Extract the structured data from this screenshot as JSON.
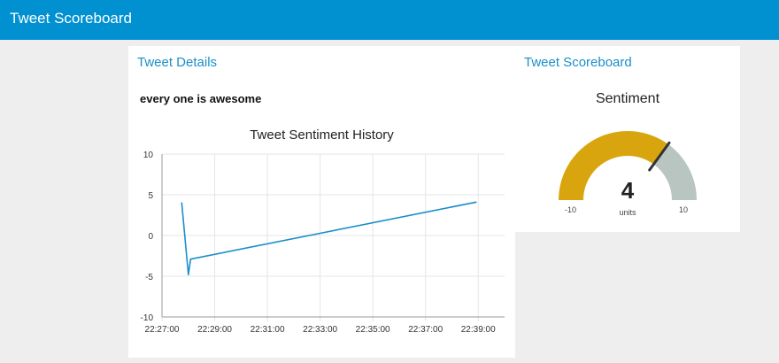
{
  "header": {
    "title": "Tweet Scoreboard"
  },
  "tweet_details": {
    "title": "Tweet Details",
    "text": "every one is awesome"
  },
  "scoreboard": {
    "title": "Tweet Scoreboard",
    "gauge": {
      "label": "Sentiment",
      "value": "4",
      "units": "units",
      "min": "-10",
      "max": "10",
      "numeric_value": 4,
      "numeric_min": -10,
      "numeric_max": 10,
      "fill_color": "#d9a50f",
      "remainder_color": "#b8c5c1",
      "needle_color": "#333333"
    }
  },
  "colors": {
    "header_bg": "#0190d0",
    "accent": "#1a8fca",
    "line": "#1a8fca"
  },
  "chart_data": {
    "type": "line",
    "title": "Tweet Sentiment History",
    "xlabel": "",
    "ylabel": "",
    "ylim": [
      -10,
      10
    ],
    "yticks": [
      "10",
      "5",
      "0",
      "-5",
      "-10"
    ],
    "ytick_values": [
      10,
      5,
      0,
      -5,
      -10
    ],
    "xticks": [
      "22:27:00",
      "22:29:00",
      "22:31:00",
      "22:33:00",
      "22:35:00",
      "22:37:00",
      "22:39:00"
    ],
    "xtick_values": [
      "22:27:00",
      "22:29:00",
      "22:31:00",
      "22:33:00",
      "22:35:00",
      "22:37:00",
      "22:39:00"
    ],
    "grid": true,
    "series": [
      {
        "x": [
          "22:27:45",
          "22:28:00",
          "22:28:05",
          "22:38:55"
        ],
        "y": [
          4,
          -4.8,
          -2.9,
          4.1
        ],
        "color": "#1a8fca"
      }
    ]
  }
}
